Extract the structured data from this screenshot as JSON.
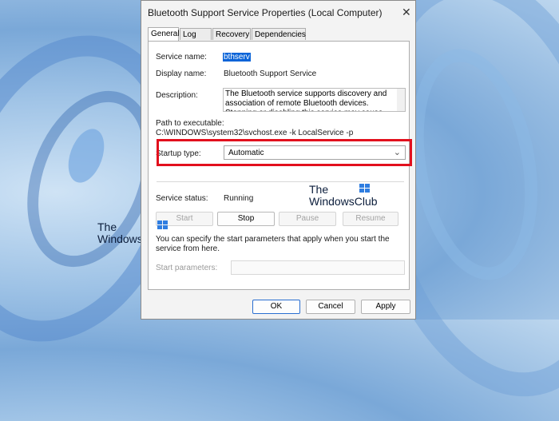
{
  "watermarks": [
    {
      "line1": "The",
      "line2": "WindowsClub"
    },
    {
      "line1": "The",
      "line2": "WindowsClub"
    }
  ],
  "dialog": {
    "title": "Bluetooth Support Service Properties (Local Computer)",
    "close_glyph": "✕",
    "tabs": [
      {
        "label": "General",
        "active": true
      },
      {
        "label": "Log On",
        "active": false
      },
      {
        "label": "Recovery",
        "active": false
      },
      {
        "label": "Dependencies",
        "active": false
      }
    ],
    "general": {
      "service_name_label": "Service name:",
      "service_name_value": "bthserv",
      "display_name_label": "Display name:",
      "display_name_value": "Bluetooth Support Service",
      "description_label": "Description:",
      "description_value": "The Bluetooth service supports discovery and association of remote Bluetooth devices.  Stopping or disabling this service may cause already installed",
      "path_label": "Path to executable:",
      "path_value": "C:\\WINDOWS\\system32\\svchost.exe -k LocalService -p",
      "startup_type_label": "Startup type:",
      "startup_type_value": "Automatic",
      "service_status_label": "Service status:",
      "service_status_value": "Running",
      "buttons": {
        "start": "Start",
        "stop": "Stop",
        "pause": "Pause",
        "resume": "Resume"
      },
      "help_text": "You can specify the start parameters that apply when you start the service from here.",
      "start_params_label": "Start parameters:",
      "start_params_value": ""
    },
    "footer": {
      "ok": "OK",
      "cancel": "Cancel",
      "apply": "Apply"
    }
  },
  "colors": {
    "highlight_box": "#e2101d",
    "selection": "#0a64d8"
  }
}
